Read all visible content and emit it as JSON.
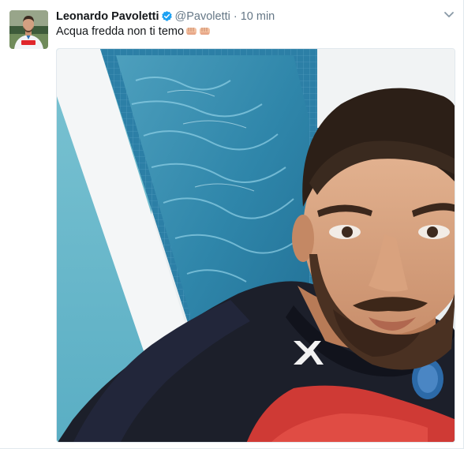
{
  "tweet": {
    "author_name": "Leonardo Pavoletti",
    "handle": "@Pavoletti",
    "separator": "·",
    "time": "10 min",
    "text": "Acqua fredda non ti temo",
    "text_emoji": [
      "punch-emoji",
      "punch-emoji"
    ],
    "verified": true
  },
  "icons": {
    "verified": "verified-badge-icon",
    "caret": "chevron-down-icon"
  },
  "colors": {
    "verified_blue": "#1da1f2",
    "secondary_text": "#657786",
    "primary_text": "#14171a"
  }
}
